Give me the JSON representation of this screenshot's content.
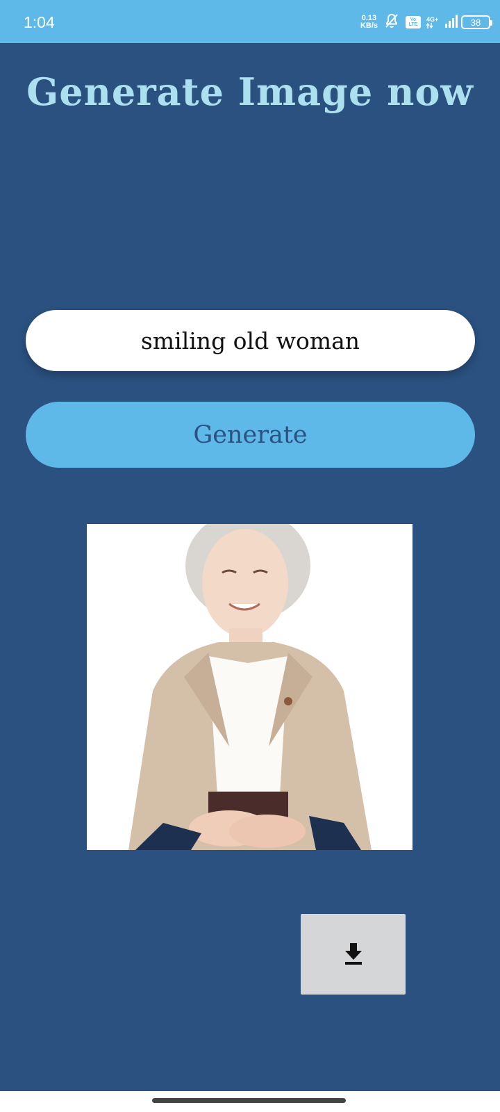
{
  "status_bar": {
    "time": "1:04",
    "net_speed_value": "0.13",
    "net_speed_unit": "KB/s",
    "volte_top": "Vo",
    "volte_bottom": "LTE",
    "network_type": "4G+",
    "battery_level": "38",
    "icons": [
      "mute-bell-icon",
      "volte-icon",
      "signal-icon",
      "battery-icon"
    ]
  },
  "main": {
    "title": "Generate Image now",
    "prompt_value": "smiling old woman",
    "generate_label": "Generate",
    "image_icon": "generated-portrait-image",
    "download_icon": "download-icon"
  },
  "colors": {
    "background": "#2b5180",
    "status_bar": "#5fb9e8",
    "title": "#ace0ef",
    "button": "#5fb9e8",
    "button_text": "#2b5180",
    "download_bg": "#d5d6d7"
  }
}
